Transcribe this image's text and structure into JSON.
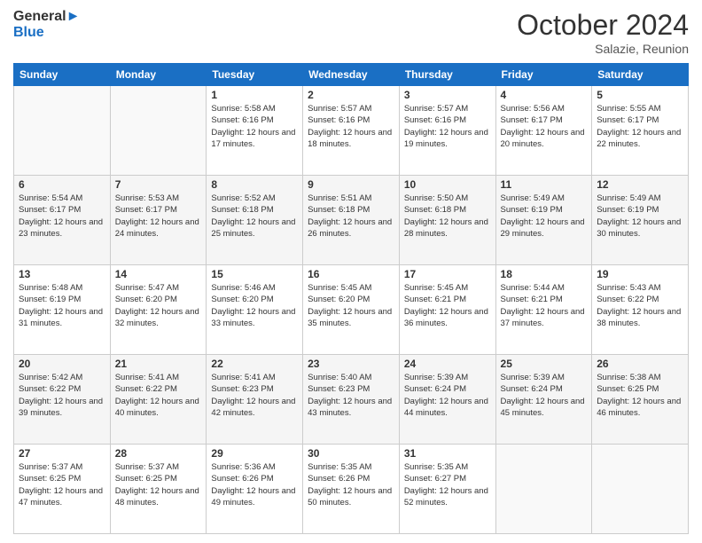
{
  "header": {
    "logo_line1": "General",
    "logo_line2": "Blue",
    "month": "October 2024",
    "location": "Salazie, Reunion"
  },
  "weekdays": [
    "Sunday",
    "Monday",
    "Tuesday",
    "Wednesday",
    "Thursday",
    "Friday",
    "Saturday"
  ],
  "weeks": [
    [
      {
        "day": "",
        "detail": ""
      },
      {
        "day": "",
        "detail": ""
      },
      {
        "day": "1",
        "detail": "Sunrise: 5:58 AM\nSunset: 6:16 PM\nDaylight: 12 hours and 17 minutes."
      },
      {
        "day": "2",
        "detail": "Sunrise: 5:57 AM\nSunset: 6:16 PM\nDaylight: 12 hours and 18 minutes."
      },
      {
        "day": "3",
        "detail": "Sunrise: 5:57 AM\nSunset: 6:16 PM\nDaylight: 12 hours and 19 minutes."
      },
      {
        "day": "4",
        "detail": "Sunrise: 5:56 AM\nSunset: 6:17 PM\nDaylight: 12 hours and 20 minutes."
      },
      {
        "day": "5",
        "detail": "Sunrise: 5:55 AM\nSunset: 6:17 PM\nDaylight: 12 hours and 22 minutes."
      }
    ],
    [
      {
        "day": "6",
        "detail": "Sunrise: 5:54 AM\nSunset: 6:17 PM\nDaylight: 12 hours and 23 minutes."
      },
      {
        "day": "7",
        "detail": "Sunrise: 5:53 AM\nSunset: 6:17 PM\nDaylight: 12 hours and 24 minutes."
      },
      {
        "day": "8",
        "detail": "Sunrise: 5:52 AM\nSunset: 6:18 PM\nDaylight: 12 hours and 25 minutes."
      },
      {
        "day": "9",
        "detail": "Sunrise: 5:51 AM\nSunset: 6:18 PM\nDaylight: 12 hours and 26 minutes."
      },
      {
        "day": "10",
        "detail": "Sunrise: 5:50 AM\nSunset: 6:18 PM\nDaylight: 12 hours and 28 minutes."
      },
      {
        "day": "11",
        "detail": "Sunrise: 5:49 AM\nSunset: 6:19 PM\nDaylight: 12 hours and 29 minutes."
      },
      {
        "day": "12",
        "detail": "Sunrise: 5:49 AM\nSunset: 6:19 PM\nDaylight: 12 hours and 30 minutes."
      }
    ],
    [
      {
        "day": "13",
        "detail": "Sunrise: 5:48 AM\nSunset: 6:19 PM\nDaylight: 12 hours and 31 minutes."
      },
      {
        "day": "14",
        "detail": "Sunrise: 5:47 AM\nSunset: 6:20 PM\nDaylight: 12 hours and 32 minutes."
      },
      {
        "day": "15",
        "detail": "Sunrise: 5:46 AM\nSunset: 6:20 PM\nDaylight: 12 hours and 33 minutes."
      },
      {
        "day": "16",
        "detail": "Sunrise: 5:45 AM\nSunset: 6:20 PM\nDaylight: 12 hours and 35 minutes."
      },
      {
        "day": "17",
        "detail": "Sunrise: 5:45 AM\nSunset: 6:21 PM\nDaylight: 12 hours and 36 minutes."
      },
      {
        "day": "18",
        "detail": "Sunrise: 5:44 AM\nSunset: 6:21 PM\nDaylight: 12 hours and 37 minutes."
      },
      {
        "day": "19",
        "detail": "Sunrise: 5:43 AM\nSunset: 6:22 PM\nDaylight: 12 hours and 38 minutes."
      }
    ],
    [
      {
        "day": "20",
        "detail": "Sunrise: 5:42 AM\nSunset: 6:22 PM\nDaylight: 12 hours and 39 minutes."
      },
      {
        "day": "21",
        "detail": "Sunrise: 5:41 AM\nSunset: 6:22 PM\nDaylight: 12 hours and 40 minutes."
      },
      {
        "day": "22",
        "detail": "Sunrise: 5:41 AM\nSunset: 6:23 PM\nDaylight: 12 hours and 42 minutes."
      },
      {
        "day": "23",
        "detail": "Sunrise: 5:40 AM\nSunset: 6:23 PM\nDaylight: 12 hours and 43 minutes."
      },
      {
        "day": "24",
        "detail": "Sunrise: 5:39 AM\nSunset: 6:24 PM\nDaylight: 12 hours and 44 minutes."
      },
      {
        "day": "25",
        "detail": "Sunrise: 5:39 AM\nSunset: 6:24 PM\nDaylight: 12 hours and 45 minutes."
      },
      {
        "day": "26",
        "detail": "Sunrise: 5:38 AM\nSunset: 6:25 PM\nDaylight: 12 hours and 46 minutes."
      }
    ],
    [
      {
        "day": "27",
        "detail": "Sunrise: 5:37 AM\nSunset: 6:25 PM\nDaylight: 12 hours and 47 minutes."
      },
      {
        "day": "28",
        "detail": "Sunrise: 5:37 AM\nSunset: 6:25 PM\nDaylight: 12 hours and 48 minutes."
      },
      {
        "day": "29",
        "detail": "Sunrise: 5:36 AM\nSunset: 6:26 PM\nDaylight: 12 hours and 49 minutes."
      },
      {
        "day": "30",
        "detail": "Sunrise: 5:35 AM\nSunset: 6:26 PM\nDaylight: 12 hours and 50 minutes."
      },
      {
        "day": "31",
        "detail": "Sunrise: 5:35 AM\nSunset: 6:27 PM\nDaylight: 12 hours and 52 minutes."
      },
      {
        "day": "",
        "detail": ""
      },
      {
        "day": "",
        "detail": ""
      }
    ]
  ]
}
